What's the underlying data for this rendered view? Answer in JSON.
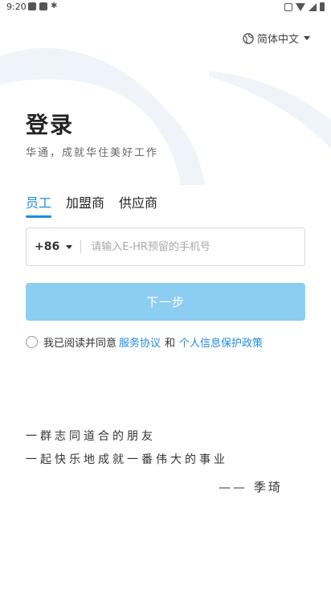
{
  "status_bar": {
    "time": "9:20",
    "left_icons": [
      "app-notification-icon",
      "app-notification-icon",
      "debug-bug-icon"
    ],
    "right_icons": [
      "vibrate-icon",
      "wifi-icon",
      "signal-icon",
      "battery-icon"
    ]
  },
  "language": {
    "label": "简体中文",
    "icon": "globe-icon"
  },
  "login": {
    "title": "登录",
    "subtitle": "华通，成就华住美好工作"
  },
  "tabs": [
    {
      "label": "员工",
      "active": true
    },
    {
      "label": "加盟商",
      "active": false
    },
    {
      "label": "供应商",
      "active": false
    }
  ],
  "phone": {
    "country_code": "+86",
    "placeholder": "请输入E-HR预留的手机号",
    "value": ""
  },
  "next_button": {
    "label": "下一步"
  },
  "agreement": {
    "prefix": "我已阅读并同意",
    "service_link": "服务协议",
    "and": "和",
    "privacy_link": "个人信息保护政策",
    "checked": false
  },
  "quote": {
    "line1": "一群志同道合的朋友",
    "line2": "一起快乐地成就一番伟大的事业",
    "author": "—— 季琦"
  },
  "colors": {
    "accent": "#1f8be0",
    "button_disabled": "#8ccdf2",
    "swoosh": "#eef4f9"
  }
}
